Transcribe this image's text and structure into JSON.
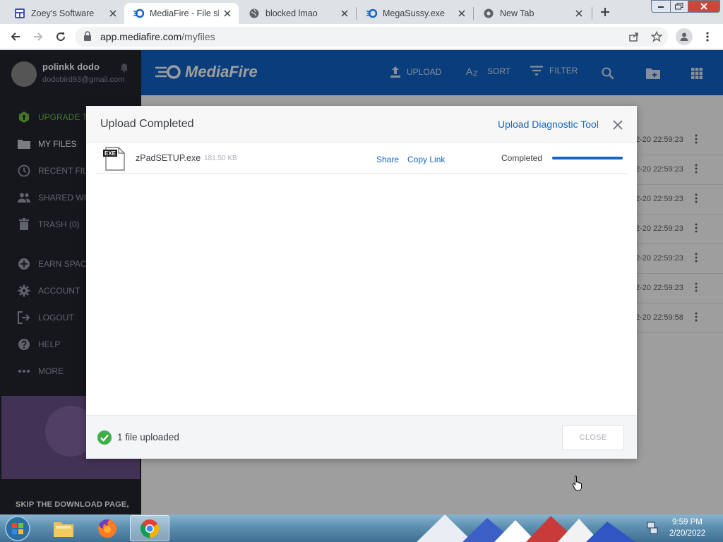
{
  "browser": {
    "tabs": [
      {
        "title": "Zoey's Software",
        "favicon": "app-grid-icon"
      },
      {
        "title": "MediaFire - File sh",
        "favicon": "mediafire-icon",
        "active": true
      },
      {
        "title": "blocked lmao",
        "favicon": "globe-icon"
      },
      {
        "title": "MegaSussy.exe",
        "favicon": "mediafire-icon"
      },
      {
        "title": "New Tab",
        "favicon": "chrome-icon"
      }
    ],
    "url_host": "app.mediafire.com",
    "url_path": "/myfiles"
  },
  "sidebar": {
    "user_name": "polinkk dodo",
    "user_email": "dodobird93@gmail.com",
    "items": [
      {
        "label": "UPGRADE TO",
        "icon": "upgrade-icon"
      },
      {
        "label": "MY FILES",
        "icon": "folder-icon"
      },
      {
        "label": "RECENT FILES",
        "icon": "clock-icon"
      },
      {
        "label": "SHARED WITH",
        "icon": "people-icon"
      },
      {
        "label": "TRASH (0)",
        "icon": "trash-icon"
      },
      {
        "label": "EARN SPACE",
        "icon": "plus-circle-icon"
      },
      {
        "label": "ACCOUNT",
        "icon": "gear-icon"
      },
      {
        "label": "LOGOUT",
        "icon": "logout-icon"
      },
      {
        "label": "HELP",
        "icon": "help-icon"
      },
      {
        "label": "MORE",
        "icon": "more-icon"
      }
    ],
    "skip_text": "SKIP THE DOWNLOAD PAGE,"
  },
  "header": {
    "logo": "MediaFire",
    "upload": "UPLOAD",
    "sort": "SORT",
    "filter": "FILTER"
  },
  "file_list": {
    "dates": [
      "2-20 22:59:23",
      "2-20 22:59:23",
      "2-20 22:59:23",
      "2-20 22:59:23",
      "2-20 22:59:23",
      "2-20 22:59:23",
      "2-20 22:59:58"
    ]
  },
  "modal": {
    "title": "Upload Completed",
    "diagnostic_link": "Upload Diagnostic Tool",
    "file": {
      "icon_label": "EXE",
      "name": "zPadSETUP.exe",
      "size": "181.50 KB",
      "share": "Share",
      "copy_link": "Copy Link",
      "status": "Completed",
      "progress": 1.0
    },
    "footer_status": "1 file uploaded",
    "close_label": "CLOSE"
  },
  "taskbar": {
    "time": "9:59 PM",
    "date": "2/20/2022",
    "apps": [
      "windows-explorer-icon",
      "firefox-icon",
      "chrome-icon"
    ]
  },
  "colors": {
    "mediafire_blue": "#1163c9",
    "link_blue": "#1566c9",
    "sidebar_bg": "#23262f",
    "success_green": "#3fae49"
  }
}
